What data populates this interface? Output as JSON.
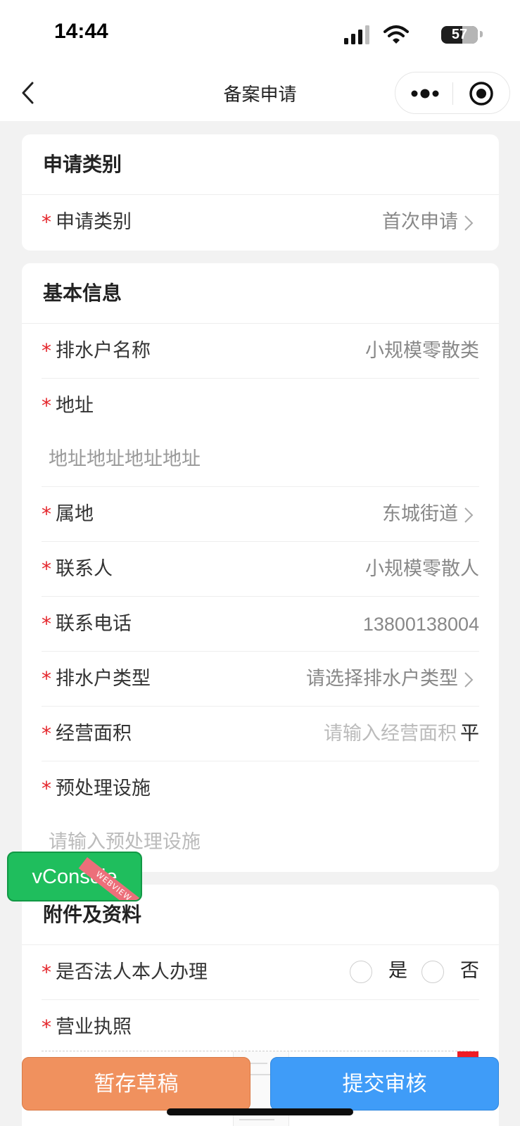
{
  "status_bar": {
    "time": "14:44",
    "battery": "57",
    "battery_level": 0.57
  },
  "nav": {
    "title": "备案申请"
  },
  "section_type": {
    "title": "申请类别",
    "rows": [
      {
        "label": "申请类别",
        "value": "首次申请",
        "required": true
      }
    ]
  },
  "section_basic": {
    "title": "基本信息",
    "rows": {
      "name": {
        "label": "排水户名称",
        "value": "小规模零散类"
      },
      "address": {
        "label": "地址",
        "value": "地址地址地址地址"
      },
      "district": {
        "label": "属地",
        "value": "东城街道"
      },
      "contact": {
        "label": "联系人",
        "value": "小规模零散人"
      },
      "phone": {
        "label": "联系电话",
        "value": "13800138004"
      },
      "type": {
        "label": "排水户类型",
        "placeholder": "请选择排水户类型"
      },
      "area": {
        "label": "经营面积",
        "placeholder": "请输入经营面积",
        "unit": "平"
      },
      "facility": {
        "label": "预处理设施",
        "placeholder": "请输入预处理设施"
      }
    }
  },
  "section_attach": {
    "title": "附件及资料",
    "legal_person": {
      "label": "是否法人本人办理",
      "options": [
        "是",
        "否"
      ]
    },
    "license": {
      "label": "营业执照"
    }
  },
  "buttons": {
    "draft": "暂存草稿",
    "submit": "提交审核"
  },
  "vconsole": {
    "label": "vConsole",
    "ribbon": "WEBVIEW"
  },
  "required_mark": "*"
}
